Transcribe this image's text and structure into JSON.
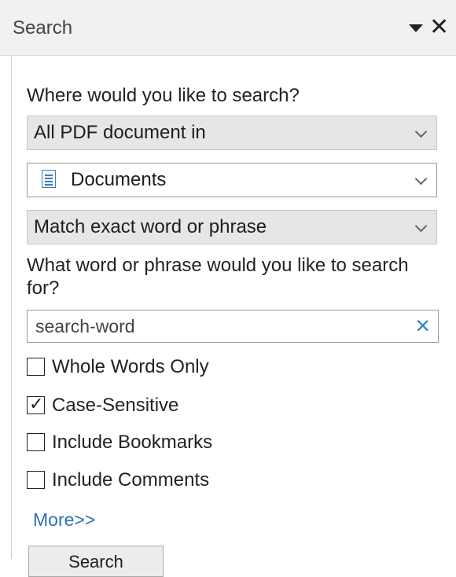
{
  "header": {
    "title": "Search"
  },
  "panel": {
    "where_label": "Where would you like to search?",
    "scope_select": {
      "value": "All PDF document in"
    },
    "location_select": {
      "value": "Documents",
      "icon": "document-icon"
    },
    "match_select": {
      "value": "Match exact word or phrase"
    },
    "phrase_label": "What word or phrase would you like to search for?",
    "search_input": {
      "value": "search-word"
    },
    "options": [
      {
        "label": "Whole Words Only",
        "checked": false
      },
      {
        "label": "Case-Sensitive",
        "checked": true
      },
      {
        "label": "Include Bookmarks",
        "checked": false
      },
      {
        "label": "Include Comments",
        "checked": false
      }
    ],
    "more_link": "More>>",
    "search_button": "Search"
  }
}
